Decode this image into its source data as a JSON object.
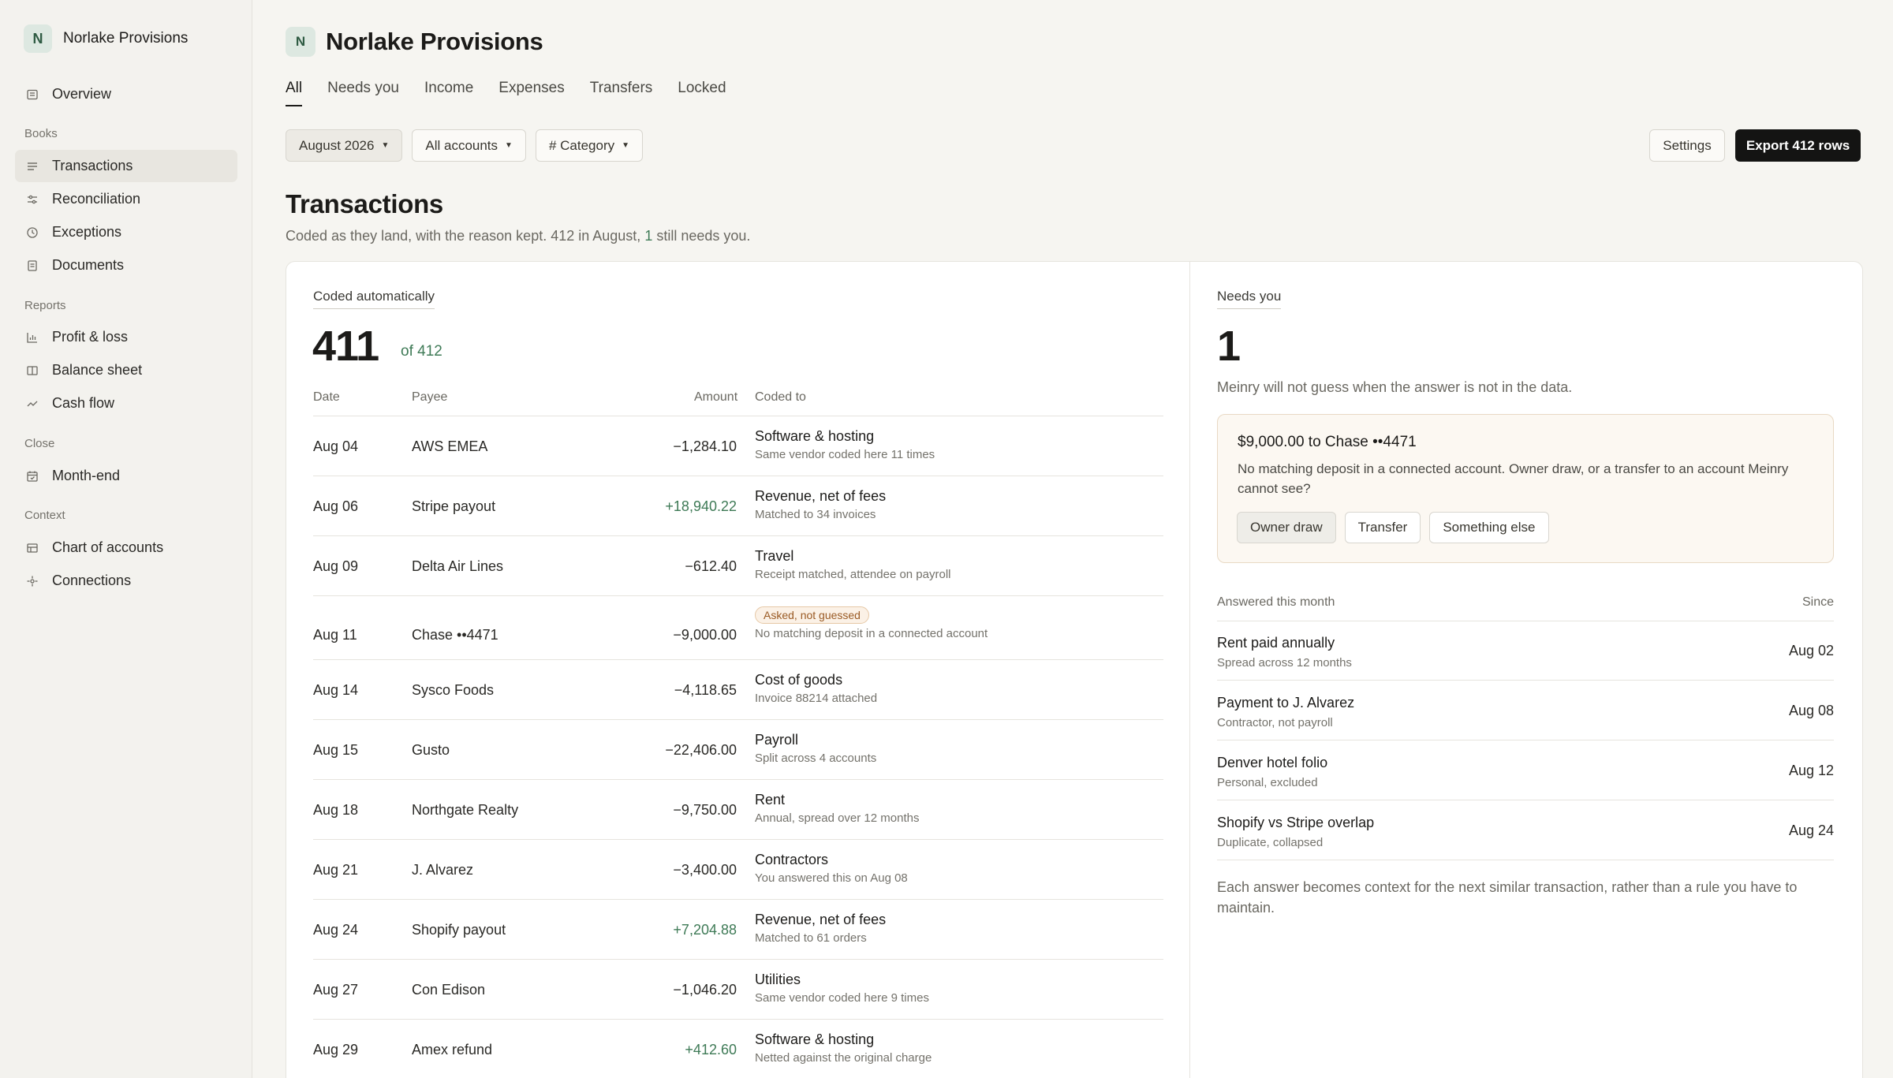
{
  "app": {
    "name": "Norlake Provisions",
    "logo_letter": "N"
  },
  "sidebar": {
    "overview": "Overview",
    "sections": {
      "books": "Books",
      "reports": "Reports",
      "close": "Close",
      "context": "Context"
    },
    "books_items": [
      "Transactions",
      "Reconciliation",
      "Exceptions",
      "Documents"
    ],
    "reports_items": [
      "Profit & loss",
      "Balance sheet",
      "Cash flow"
    ],
    "close_items": [
      "Month-end"
    ],
    "context_items": [
      "Chart of accounts",
      "Connections"
    ]
  },
  "header": {
    "title": "Norlake Provisions"
  },
  "tabs": [
    "All",
    "Needs you",
    "Income",
    "Expenses",
    "Transfers",
    "Locked"
  ],
  "filters": {
    "period": "August 2026",
    "accounts": "All accounts",
    "category": "# Category"
  },
  "actions": {
    "settings": "Settings",
    "export": "Export 412 rows"
  },
  "main": {
    "title": "Transactions",
    "subtitle_a": "Coded as they land, with the reason kept. 412 in August,",
    "subtitle_num": "1",
    "subtitle_b": "still needs you."
  },
  "coded": {
    "label": "Coded automatically",
    "count": "411",
    "of_total": "of 412",
    "columns": {
      "date": "Date",
      "payee": "Payee",
      "amount": "Amount",
      "coded_to": "Coded to"
    },
    "rows": [
      {
        "date": "Aug 04",
        "payee": "AWS EMEA",
        "amount": "−1,284.10",
        "category": "Software & hosting",
        "reason": "Same vendor coded here 11 times"
      },
      {
        "date": "Aug 06",
        "payee": "Stripe payout",
        "amount": "+18,940.22",
        "category": "Revenue, net of fees",
        "reason": "Matched to 34 invoices"
      },
      {
        "date": "Aug 09",
        "payee": "Delta Air Lines",
        "amount": "−612.40",
        "category": "Travel",
        "reason": "Receipt matched, attendee on payroll"
      },
      {
        "date": "Aug 11",
        "payee": "Chase ••4471",
        "amount": "−9,000.00",
        "badge": "Asked, not guessed",
        "reason": "No matching deposit in a connected account"
      },
      {
        "date": "Aug 14",
        "payee": "Sysco Foods",
        "amount": "−4,118.65",
        "category": "Cost of goods",
        "reason": "Invoice 88214 attached"
      },
      {
        "date": "Aug 15",
        "payee": "Gusto",
        "amount": "−22,406.00",
        "category": "Payroll",
        "reason": "Split across 4 accounts"
      },
      {
        "date": "Aug 18",
        "payee": "Northgate Realty",
        "amount": "−9,750.00",
        "category": "Rent",
        "reason": "Annual, spread over 12 months"
      },
      {
        "date": "Aug 21",
        "payee": "J. Alvarez",
        "amount": "−3,400.00",
        "category": "Contractors",
        "reason": "You answered this on Aug 08"
      },
      {
        "date": "Aug 24",
        "payee": "Shopify payout",
        "amount": "+7,204.88",
        "category": "Revenue, net of fees",
        "reason": "Matched to 61 orders"
      },
      {
        "date": "Aug 27",
        "payee": "Con Edison",
        "amount": "−1,046.20",
        "category": "Utilities",
        "reason": "Same vendor coded here 9 times"
      },
      {
        "date": "Aug 29",
        "payee": "Amex refund",
        "amount": "+412.60",
        "category": "Software & hosting",
        "reason": "Netted against the original charge"
      }
    ]
  },
  "needs_you": {
    "label": "Needs you",
    "count": "1",
    "description": "Meinry will not guess when the answer is not in the data.",
    "callout": {
      "title": "$9,000.00 to Chase ••4471",
      "text": "No matching deposit in a connected account. Owner draw, or a transfer to an account Meinry cannot see?",
      "options": [
        "Owner draw",
        "Transfer",
        "Something else"
      ]
    },
    "answered_label": "Answered this month",
    "since_label": "Since",
    "answered": [
      {
        "title": "Rent paid annually",
        "sub": "Spread across 12 months",
        "date": "Aug 02"
      },
      {
        "title": "Payment to J. Alvarez",
        "sub": "Contractor, not payroll",
        "date": "Aug 08"
      },
      {
        "title": "Denver hotel folio",
        "sub": "Personal, excluded",
        "date": "Aug 12"
      },
      {
        "title": "Shopify vs Stripe overlap",
        "sub": "Duplicate, collapsed",
        "date": "Aug 24"
      }
    ],
    "footnote": "Each answer becomes context for the next similar transaction, rather than a rule you have to maintain."
  },
  "colors": {
    "accent_green": "#3e7a56",
    "badge_orange": "#9a5a24",
    "primary_button": "#141413"
  }
}
